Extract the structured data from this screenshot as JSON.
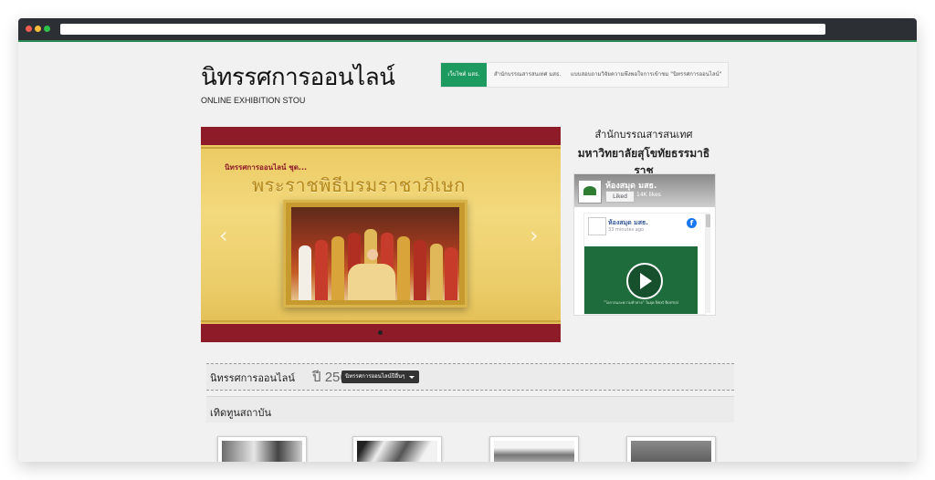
{
  "site": {
    "title": "นิทรรศการออนไลน์",
    "subtitle": "ONLINE EXHIBITION STOU"
  },
  "nav": {
    "items": [
      {
        "label": "เว็บไซต์ มสธ.",
        "active": true
      },
      {
        "label": "สำนักบรรณสารสนเทศ มสธ.",
        "active": false
      },
      {
        "label": "แบบสอบถามวิจัยความพึงพอใจการเข้าชม \"นิทรรศการออนไลน์\"",
        "active": false
      }
    ]
  },
  "slider": {
    "series": "นิทรรศการออนไลน์ ชุด...",
    "title": "พระราชพิธีบรมราชาภิเษก",
    "prev_icon": "chevron-left-icon",
    "next_icon": "chevron-right-icon"
  },
  "sidebar": {
    "title_line1": "สำนักบรรณสารสนเทศ",
    "title_line2": "มหาวิทยาลัยสุโขทัยธรรมาธิราช"
  },
  "facebook": {
    "page_name": "ห้องสมุด มสธ.",
    "like_label": "Liked",
    "likes": "14K likes",
    "post_author": "ห้องสมุด มสธ.",
    "post_time": "33 minutes ago",
    "video_caption": "\"โอกาสและความท้าทาย\" ในยุค Next Normal",
    "brand_color": "#1877f2"
  },
  "sections": {
    "exhibition_label": "นิทรรศการออนไลน์",
    "exhibition_year": "ปี 2564",
    "dropdown_label": "นิทรรศการออนไลน์ปีอื่นๆ",
    "tribute_label": "เทิดทูนสถาบัน"
  },
  "colors": {
    "accent_green": "#1c9a5f",
    "maroon": "#8e1b28",
    "gold": "#e9c65b"
  }
}
